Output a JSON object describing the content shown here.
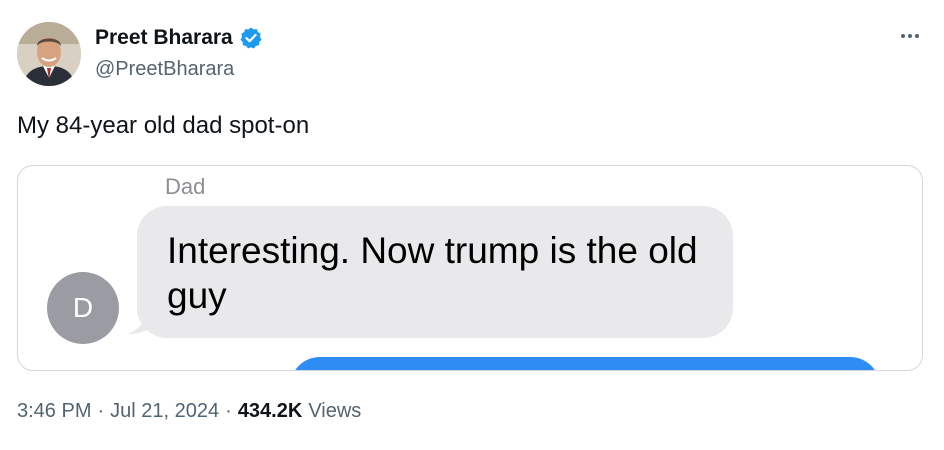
{
  "author": {
    "display_name": "Preet Bharara",
    "handle": "@PreetBharara",
    "verified": true,
    "avatar_icon": "profile-photo"
  },
  "tweet": {
    "text": "My 84-year old dad spot-on"
  },
  "media": {
    "sender": "Dad",
    "message": "Interesting. Now trump is the old guy",
    "contact_initial": "D",
    "incoming_bubble_color": "#e9e9eb",
    "outgoing_bubble_color": "#2e8df5"
  },
  "meta": {
    "time": "3:46 PM",
    "separator": "·",
    "date": "Jul 21, 2024",
    "views_count": "434.2K",
    "views_label": "Views"
  },
  "colors": {
    "verified_badge": "#1d9bf0",
    "secondary_text": "#536471",
    "primary_text": "#0f1419"
  }
}
